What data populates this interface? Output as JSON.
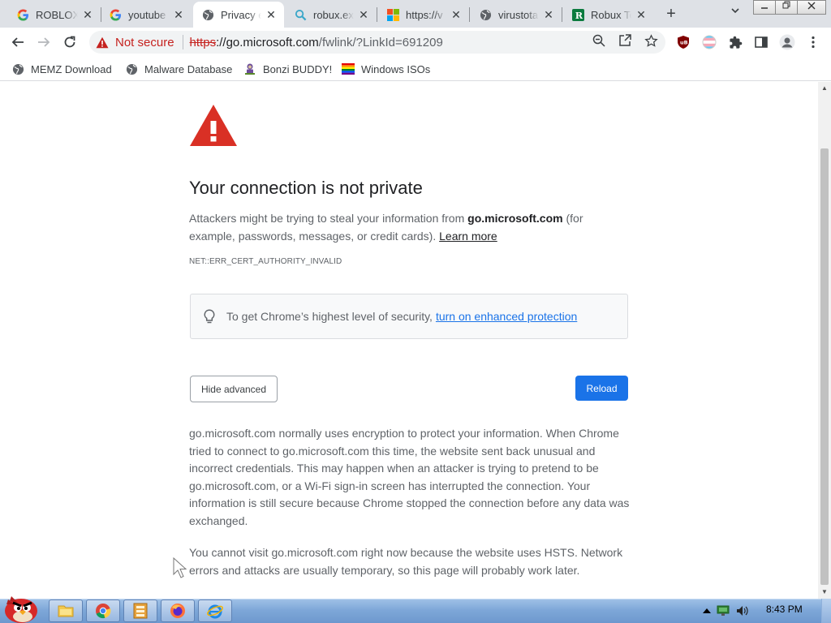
{
  "tabs": [
    {
      "title": "ROBLOX",
      "favicon": "google-icon"
    },
    {
      "title": "youtube",
      "favicon": "google-icon"
    },
    {
      "title": "Privacy e",
      "favicon": "globe-icon",
      "active": true
    },
    {
      "title": "robux.ex",
      "favicon": "search-icon"
    },
    {
      "title": "https://v",
      "favicon": "microsoft-icon"
    },
    {
      "title": "virustota",
      "favicon": "globe-icon"
    },
    {
      "title": "Robux To",
      "favicon": "robux-icon"
    }
  ],
  "toolbar": {
    "not_secure": "Not secure",
    "url_scheme": "https",
    "url_host": "://go.microsoft.com",
    "url_path": "/fwlink/?LinkId=691209"
  },
  "bookmarks": [
    {
      "label": "MEMZ Download",
      "icon": "globe-icon"
    },
    {
      "label": "Malware Database",
      "icon": "globe-icon"
    },
    {
      "label": "Bonzi BUDDY!",
      "icon": "bonzi-icon"
    },
    {
      "label": "Windows ISOs",
      "icon": "rainbow-flag-icon"
    }
  ],
  "error": {
    "title": "Your connection is not private",
    "intro_pre": "Attackers might be trying to steal your information from ",
    "intro_host": "go.microsoft.com",
    "intro_post": " (for example, passwords, messages, or credit cards). ",
    "learn_more": "Learn more",
    "code": "NET::ERR_CERT_AUTHORITY_INVALID",
    "enhanced_pre": "To get Chrome’s highest level of security,",
    "enhanced_link": "turn on enhanced protection",
    "hide_advanced": "Hide advanced",
    "reload": "Reload",
    "details_1": "go.microsoft.com normally uses encryption to protect your information. When Chrome tried to connect to go.microsoft.com this time, the website sent back unusual and incorrect credentials. This may happen when an attacker is trying to pretend to be go.microsoft.com, or a Wi-Fi sign-in screen has interrupted the connection. Your information is still secure because Chrome stopped the connection before any data was exchanged.",
    "details_2": "You cannot visit go.microsoft.com right now because the website uses HSTS. Network errors and attacks are usually temporary, so this page will probably work later."
  },
  "taskbar": {
    "apps": [
      "explorer-icon",
      "chrome-icon",
      "archive-icon",
      "firefox-icon",
      "ie-icon"
    ],
    "clock": "8:43 PM"
  },
  "colors": {
    "warning_red": "#d93025",
    "link_blue": "#1a73e8",
    "not_secure_red": "#c5221f"
  }
}
